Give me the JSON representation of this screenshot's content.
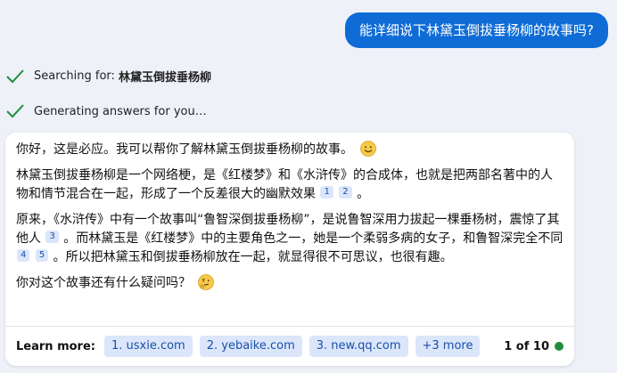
{
  "user_message": "能详细说下林黛玉倒拔垂杨柳的故事吗?",
  "status": [
    {
      "prefix": "Searching for:",
      "query": "林黛玉倒拔垂杨柳"
    },
    {
      "prefix": "Generating answers for you…",
      "query": ""
    }
  ],
  "answer": {
    "p1": "你好，这是必应。我可以帮你了解林黛玉倒拔垂杨柳的故事。",
    "p2_text": "林黛玉倒拔垂杨柳是一个网络梗，是《红楼梦》和《水浒传》的合成体，也就是把两部名著中的人物和情节混合在一起，形成了一个反差很大的幽默效果",
    "p2_cites": [
      "1",
      "2"
    ],
    "p2_end": "。",
    "p3_a": "原来，《水浒传》中有一个故事叫“鲁智深倒拔垂杨柳”，是说鲁智深用力拔起一棵垂杨树，震惊了其他人",
    "p3_cite_a": "3",
    "p3_b": "。而林黛玉是《红楼梦》中的主要角色之一，她是一个柔弱多病的女子，和鲁智深完全不同",
    "p3_cites_b": [
      "4",
      "5"
    ],
    "p3_c": "。所以把林黛玉和倒拔垂杨柳放在一起，就显得很不可思议，也很有趣。",
    "p4": "你对这个故事还有什么疑问吗？"
  },
  "learn_more": {
    "label": "Learn more:",
    "links": [
      "1. usxie.com",
      "2. yebaike.com",
      "3. new.qq.com",
      "+3 more"
    ],
    "page": "1 of 10"
  },
  "colors": {
    "accent": "#0f6cd6",
    "check": "#1e8e3e",
    "chip_bg": "#dbe6fb",
    "chip_text": "#1a4fa8"
  }
}
